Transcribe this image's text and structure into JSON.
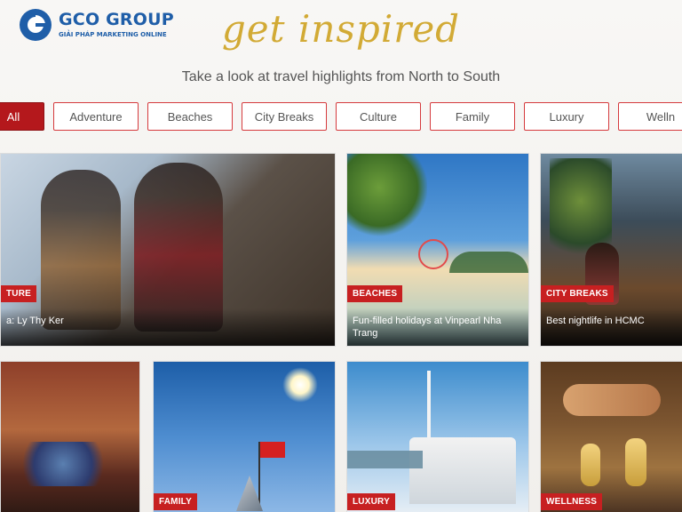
{
  "brand": {
    "name": "GCO GROUP",
    "tagline": "GIẢI PHÁP MARKETING ONLINE"
  },
  "hero": {
    "title": "get inspired",
    "subtitle": "Take a look at travel highlights from North to South"
  },
  "filters": [
    {
      "label": "All",
      "active": true
    },
    {
      "label": "Adventure",
      "active": false
    },
    {
      "label": "Beaches",
      "active": false
    },
    {
      "label": "City Breaks",
      "active": false
    },
    {
      "label": "Culture",
      "active": false
    },
    {
      "label": "Family",
      "active": false
    },
    {
      "label": "Luxury",
      "active": false
    },
    {
      "label": "Welln",
      "active": false
    }
  ],
  "cards": [
    {
      "category": "TURE",
      "caption": "a: Ly Thy Ker"
    },
    {
      "category": "BEACHES",
      "caption": "Fun-filled holidays at Vinpearl Nha Trang"
    },
    {
      "category": "CITY BREAKS",
      "caption": "Best nightlife in HCMC"
    },
    {
      "category": "",
      "caption": ""
    },
    {
      "category": "FAMILY",
      "caption": ""
    },
    {
      "category": "LUXURY",
      "caption": ""
    },
    {
      "category": "WELLNESS",
      "caption": ""
    }
  ]
}
